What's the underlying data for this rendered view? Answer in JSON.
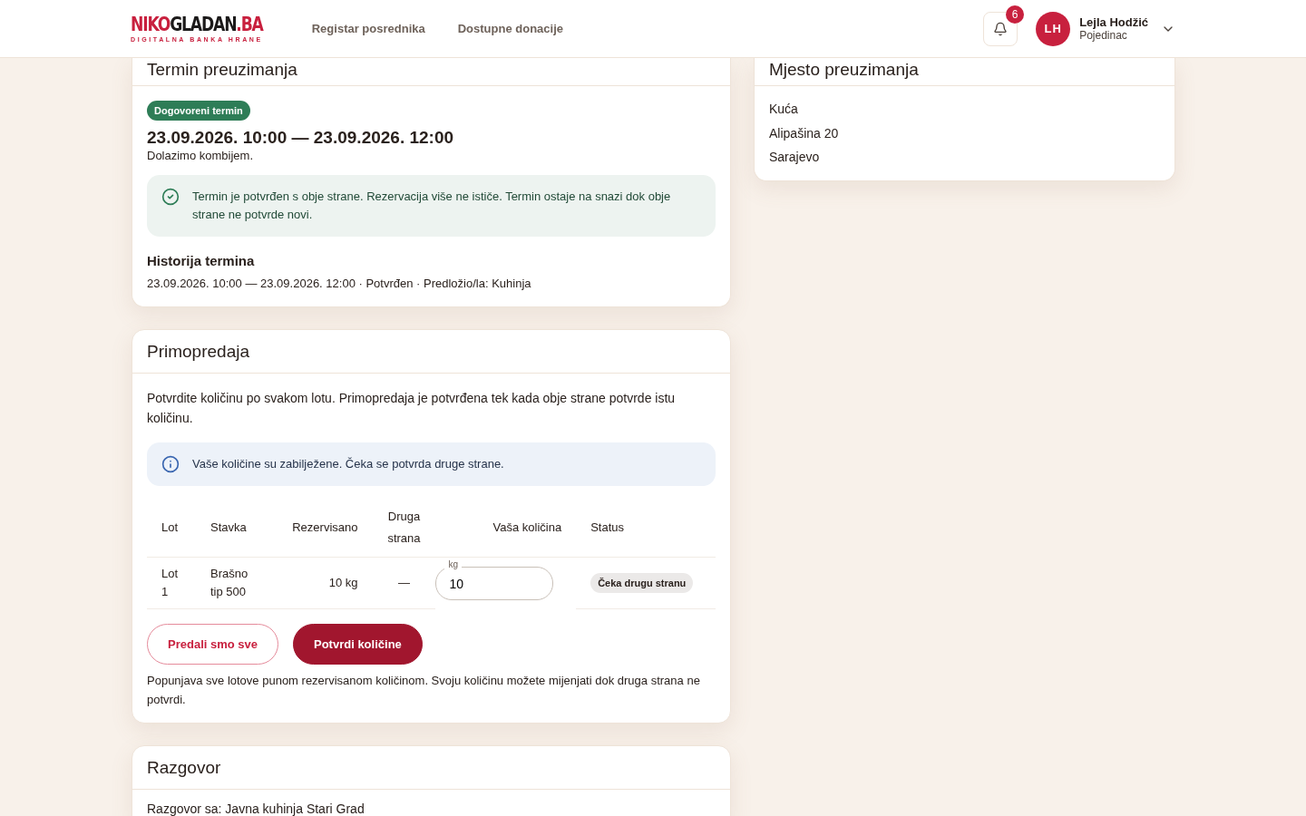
{
  "header": {
    "logo": {
      "first": "NIKO",
      "second": "GLADAN",
      "suffix": ".BA",
      "tagline": "DIGITALNA BANKA HRANE"
    },
    "nav": [
      {
        "label": "Registar posrednika",
        "selected": false
      },
      {
        "label": "Dostupne donacije",
        "selected": false
      }
    ],
    "notifications": {
      "count": "6"
    },
    "user": {
      "initials": "LH",
      "name": "Lejla Hodžić",
      "role": "Pojedinac"
    }
  },
  "termin": {
    "title": "Termin preuzimanja",
    "badge": "Dogovoreni termin",
    "range": "23.09.2026. 10:00 — 23.09.2026. 12:00",
    "note": "Dolazimo kombijem.",
    "alert": {
      "kind": "success",
      "text": "Termin je potvrđen s obje strane. Rezervacija više ne ističe. Termin ostaje na snazi dok obje strane ne potvrde novi."
    },
    "history_title": "Historija termina",
    "history": [
      "23.09.2026. 10:00 — 23.09.2026. 12:00 · Potvrđen · Predložio/la: Kuhinja"
    ]
  },
  "mjesto": {
    "title": "Mjesto preuzimanja",
    "lines": [
      "Kuća",
      "Alipašina 20",
      "Sarajevo"
    ]
  },
  "primopredaja": {
    "title": "Primopredaja",
    "intro": "Potvrdite količinu po svakom lotu. Primopredaja je potvrđena tek kada obje strane potvrde istu količinu.",
    "alert": {
      "kind": "info",
      "text": "Vaše količine su zabilježene. Čeka se potvrda druge strane."
    },
    "table": {
      "columns": [
        "Lot",
        "Stavka",
        "Rezervisano",
        "Druga strana",
        "Vaša količina",
        "Status"
      ],
      "rows": [
        {
          "lot": "Lot 1",
          "item": "Brašno tip 500",
          "reserved": "10 kg",
          "other": "—",
          "unit": "kg",
          "value": "10",
          "status": "Čeka drugu stranu"
        }
      ]
    },
    "buttons": [
      {
        "label": "Predali smo sve",
        "kind": "outline"
      },
      {
        "label": "Potvrdi količine",
        "kind": "primary"
      }
    ],
    "footnote": "Popunjava sve lotove punom rezervisanom količinom. Svoju količinu možete mijenjati dok druga strana ne potvrdi."
  },
  "razgovor": {
    "title": "Razgovor",
    "with": "Razgovor sa: Javna kuhinja Stari Grad"
  }
}
